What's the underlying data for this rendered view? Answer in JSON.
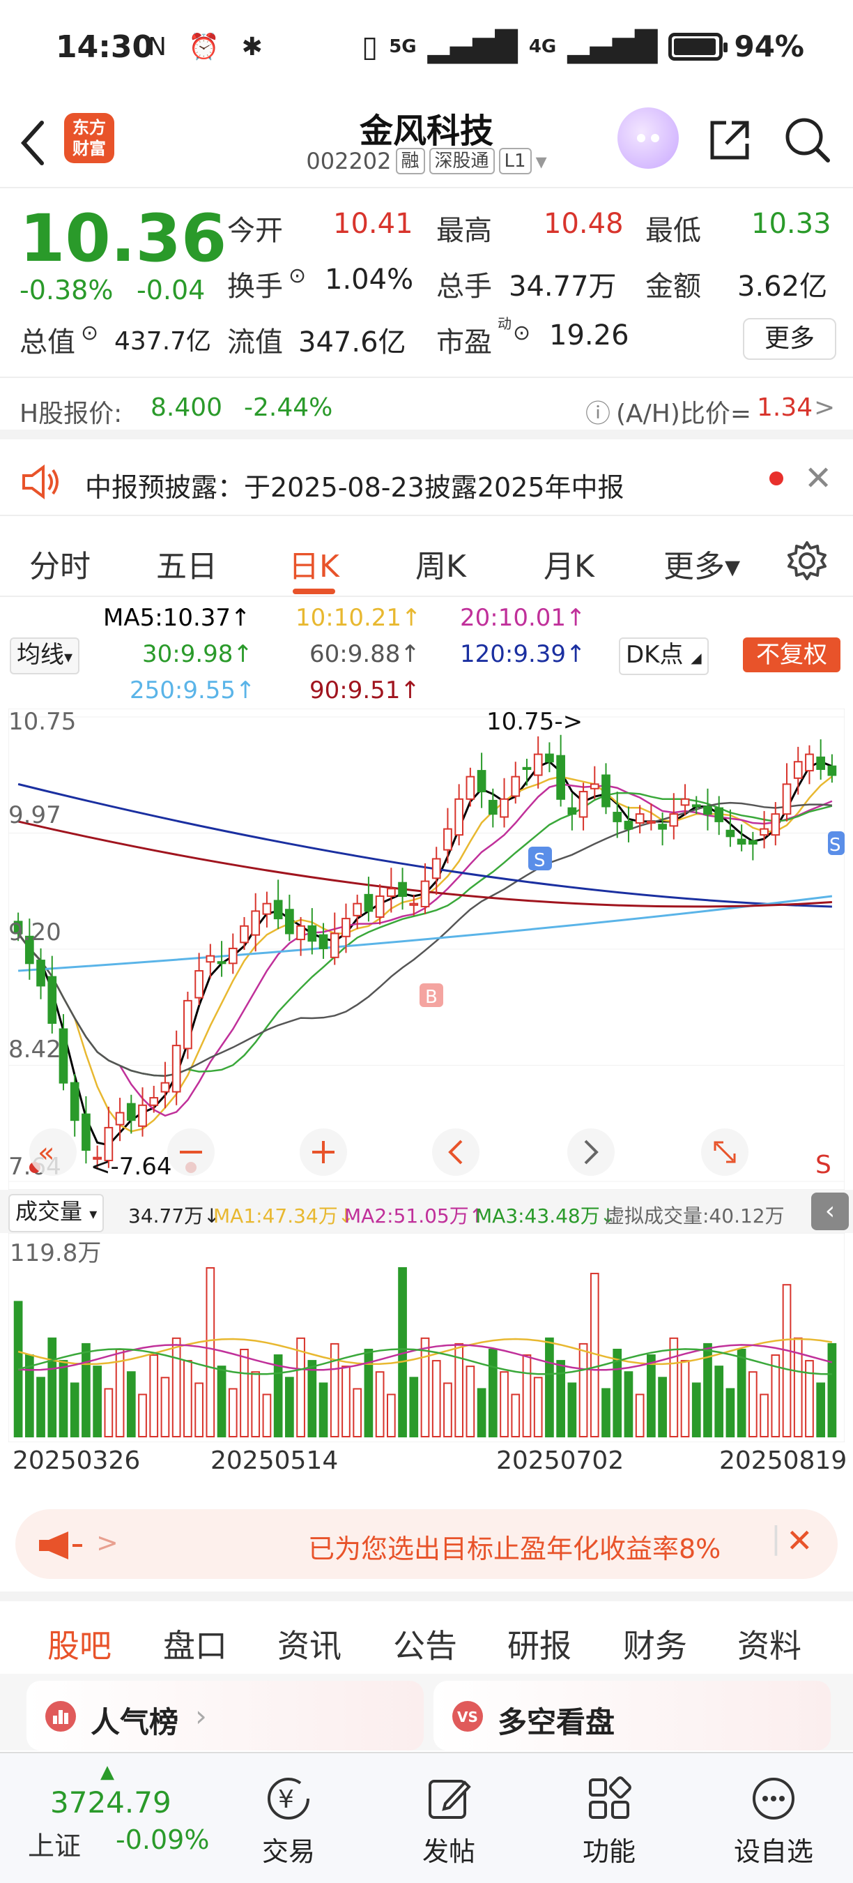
{
  "status_bar": {
    "time": "14:30",
    "left_icons": "N ⏰ ✱",
    "signal1": "5G",
    "signal2": "4G",
    "battery": "94%"
  },
  "header": {
    "stock_name": "金风科技",
    "code": "002202",
    "tags": [
      "融",
      "深股通",
      "L1"
    ],
    "logo_text": "东方\n财富"
  },
  "quote": {
    "price": "10.36",
    "change_pct": "-0.38%",
    "change": "-0.04",
    "open_label": "今开",
    "open": "10.41",
    "high_label": "最高",
    "high": "10.48",
    "low_label": "最低",
    "low": "10.33",
    "turnover_label": "换手",
    "turnover": "1.04%",
    "volume_label": "总手",
    "volume": "34.77万",
    "amount_label": "金额",
    "amount": "3.62亿",
    "mcap_label": "总值",
    "mcap": "437.7亿",
    "float_label": "流值",
    "float": "347.6亿",
    "pe_label": "市盈",
    "pe_sup": "动",
    "pe": "19.26",
    "more_label": "更多"
  },
  "hshare": {
    "label": "H股报价:",
    "price": "8.400",
    "change": "-2.44%",
    "ratio_label": "(A/H)比价=",
    "ratio": "1.34",
    "arrow": ">"
  },
  "notice": {
    "text": "中报预披露：于2025-08-23披露2025年中报"
  },
  "ktabs": [
    "分时",
    "五日",
    "日K",
    "周K",
    "月K",
    "更多▾"
  ],
  "ma_legend": {
    "select": "均线",
    "ma5": "MA5:10.37↑",
    "ma10": "10:10.21↑",
    "ma20": "20:10.01↑",
    "ma30": "30:9.98↑",
    "ma60": "60:9.88↑",
    "ma120": "120:9.39↑",
    "ma250": "250:9.55↑",
    "ma90": "90:9.51↑",
    "dk": "DK点",
    "fq": "不复权"
  },
  "colors": {
    "up": "#d8342c",
    "down": "#2a9a2a",
    "accent": "#e8532a",
    "ma5": "#000000",
    "ma10": "#e8b830",
    "ma20": "#c0309a",
    "ma30": "#3aa83a",
    "ma60": "#555555",
    "ma120": "#1a2fa0",
    "ma250": "#5ab4e8",
    "ma90": "#a0141e"
  },
  "chart_data": {
    "type": "candlestick",
    "y_ticks": [
      "10.75",
      "9.97",
      "9.20",
      "8.42",
      "7.64"
    ],
    "ylim": [
      7.64,
      10.75
    ],
    "high_annotation": "10.75->",
    "low_annotation": "<-7.64",
    "x_labels": [
      "20250326",
      "20250514",
      "20250702",
      "20250819"
    ],
    "markers": [
      "B",
      "S",
      "S",
      "S"
    ],
    "volume_label": "成交量",
    "volume_value": "34.77万↓",
    "vol_ma1": "MA1:47.34万↓",
    "vol_ma2": "MA2:51.05万↑",
    "vol_ma3": "MA3:43.48万↓",
    "virtual_volume": "虚拟成交量:40.12万",
    "vol_max_label": "119.8万",
    "close": [
      9.3,
      9.1,
      8.95,
      8.7,
      8.3,
      8.05,
      7.85,
      7.8,
      8.0,
      8.1,
      8.05,
      8.15,
      8.2,
      8.3,
      8.55,
      8.85,
      9.05,
      9.15,
      9.1,
      9.2,
      9.35,
      9.45,
      9.5,
      9.4,
      9.3,
      9.35,
      9.25,
      9.2,
      9.3,
      9.4,
      9.5,
      9.45,
      9.55,
      9.6,
      9.55,
      9.5,
      9.65,
      9.8,
      10.0,
      10.2,
      10.35,
      10.25,
      10.1,
      10.2,
      10.35,
      10.4,
      10.5,
      10.45,
      10.2,
      10.1,
      10.25,
      10.3,
      10.15,
      10.05,
      10.0,
      10.1,
      10.05,
      10.0,
      10.1,
      10.2,
      10.15,
      10.1,
      10.05,
      9.95,
      9.9,
      9.9,
      10.0,
      10.1,
      10.3,
      10.45,
      10.5,
      10.4,
      10.36
    ]
  },
  "promo": {
    "text": "已为您选出目标止盈年化收益率8%"
  },
  "bottom_tabs": [
    "股吧",
    "盘口",
    "资讯",
    "公告",
    "研报",
    "财务",
    "资料"
  ],
  "cards": {
    "left": "人气榜",
    "right": "多空看盘"
  },
  "bottom_nav": {
    "index_value": "3724.79",
    "index_name": "上证",
    "index_change": "-0.09%",
    "items": [
      "交易",
      "发帖",
      "功能",
      "设自选"
    ]
  }
}
